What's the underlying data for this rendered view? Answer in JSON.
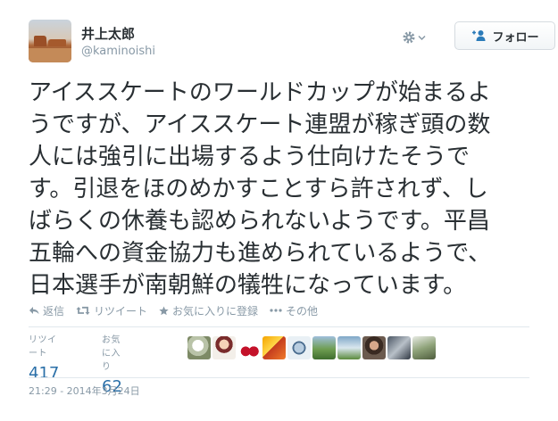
{
  "user": {
    "name": "井上太郎",
    "handle": "@kaminoishi"
  },
  "header": {
    "follow_label": "フォロー",
    "gear_icon": "gear-icon",
    "follow_icon": "add-user-icon"
  },
  "tweet": {
    "text": "アイススケートのワールドカップが始まるよ\nうですが、アイススケート連盟が稼ぎ頭の数\n人には強引に出場するよう仕向けたそうで\nす。引退をほのめかすことすら許されず、し\nばらくの休養も認められないようです。平昌\n五輪への資金協力も進められているようで、\n日本選手が南朝鮮の犠牲になっています。"
  },
  "actions": {
    "reply": "返信",
    "retweet": "リツイート",
    "favorite": "お気に入りに登録",
    "more": "その他"
  },
  "stats": {
    "retweets_label": "リツイート",
    "retweets_value": "417",
    "favorites_label": "お気に入り",
    "favorites_value": "62"
  },
  "timestamp": "21:29 - 2014年3月24日",
  "colors": {
    "link_blue": "#2b7bb9",
    "stat_blue": "#2a6fa8",
    "muted": "#8899a6",
    "text": "#292f33"
  }
}
